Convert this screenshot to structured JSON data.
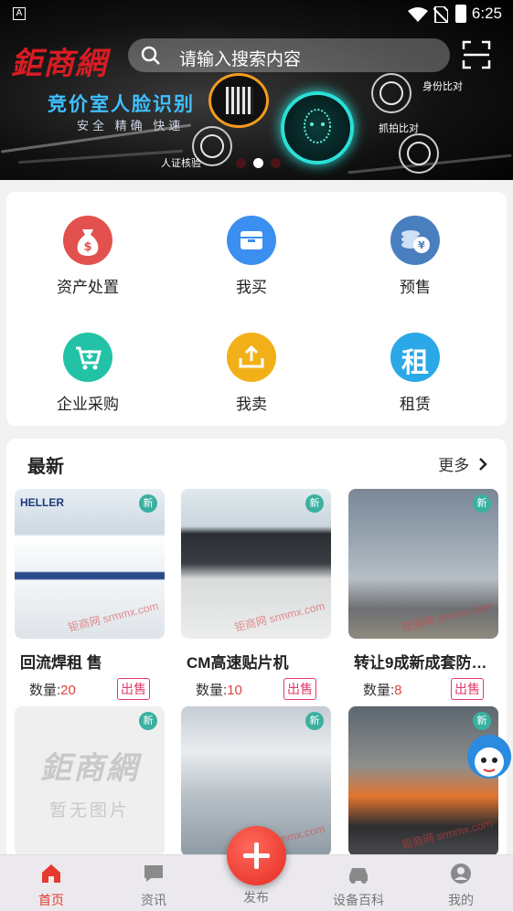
{
  "status_bar": {
    "time": "6:25",
    "left_icon": "A"
  },
  "header": {
    "logo_text": "鉅商網",
    "search_placeholder": "请输入搜索内容"
  },
  "banner": {
    "title": "竞价室人脸识别",
    "subtitle": "安全  精确  快速",
    "labels": [
      "身份比对",
      "抓拍比对",
      "人证核验"
    ],
    "active_dot": 1,
    "dot_count": 3
  },
  "categories": [
    {
      "label": "资产处置",
      "icon": "money-bag-icon",
      "color": "#e2514e"
    },
    {
      "label": "我买",
      "icon": "box-icon",
      "color": "#3b8ff0"
    },
    {
      "label": "预售",
      "icon": "coins-icon",
      "color": "#4a7fbf"
    },
    {
      "label": "企业采购",
      "icon": "cart-icon",
      "color": "#22c2a6"
    },
    {
      "label": "我卖",
      "icon": "upload-tray-icon",
      "color": "#f2b018"
    },
    {
      "label": "租赁",
      "icon": "rent-char-icon",
      "color": "#2aa8e8",
      "char": "租"
    }
  ],
  "latest": {
    "title": "最新",
    "more_label": "更多",
    "qty_label": "数量:",
    "items": [
      {
        "name": "回流焊租 售",
        "qty": "20",
        "tag": "出售",
        "new_badge": "新",
        "watermark": "钜商网 srmmx.com"
      },
      {
        "name": "CM高速贴片机",
        "qty": "10",
        "tag": "出售",
        "new_badge": "新",
        "watermark": "钜商网 srmmx.com"
      },
      {
        "name": "转让9成新成套防…",
        "qty": "8",
        "tag": "出售",
        "new_badge": "新",
        "watermark": "钜商网 srmmx.com"
      },
      {
        "name": "",
        "new_badge": "新",
        "placeholder_logo": "鉅商網",
        "placeholder_text": "暂无图片"
      },
      {
        "name": "",
        "new_badge": "新",
        "watermark": "srmmx.com"
      },
      {
        "name": "",
        "new_badge": "新",
        "watermark": "钜商网 srmmx.com"
      }
    ]
  },
  "tabbar": {
    "items": [
      {
        "label": "首页",
        "icon": "home-icon",
        "active": true
      },
      {
        "label": "资讯",
        "icon": "message-icon",
        "active": false
      },
      {
        "label": "发布",
        "icon": "plus-icon",
        "active": false
      },
      {
        "label": "设备百科",
        "icon": "car-icon",
        "active": false
      },
      {
        "label": "我的",
        "icon": "user-icon",
        "active": false
      }
    ]
  },
  "colors": {
    "accent": "#e53a2f",
    "tag": "#e03a6a",
    "qty": "#e0403a"
  }
}
